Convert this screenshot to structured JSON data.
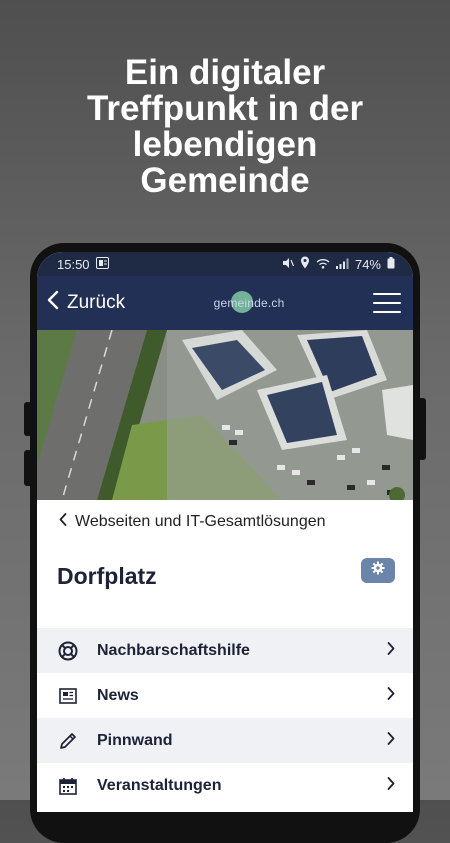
{
  "promo": {
    "headline": [
      "Ein digitaler",
      "Treffpunkt in der",
      "lebendigen",
      "Gemeinde"
    ]
  },
  "status_bar": {
    "time": "15:50",
    "battery": "74%"
  },
  "app_bar": {
    "back_label": "Zurück",
    "logo_text": "gemeinde.ch"
  },
  "breadcrumb": {
    "label": "Webseiten und IT-Gesamtlösungen"
  },
  "page": {
    "title": "Dorfplatz"
  },
  "menu_items": [
    {
      "label": "Nachbarschaftshilfe",
      "icon": "lifebuoy-icon"
    },
    {
      "label": "News",
      "icon": "newspaper-icon"
    },
    {
      "label": "Pinnwand",
      "icon": "pencil-icon"
    },
    {
      "label": "Veranstaltungen",
      "icon": "calendar-icon"
    }
  ],
  "colors": {
    "app_bar": "#233056",
    "status_bar": "#1f2a44",
    "title_text": "#1d2236",
    "gear_button": "#6a85a9",
    "row_alt": "#f0f1f4"
  }
}
